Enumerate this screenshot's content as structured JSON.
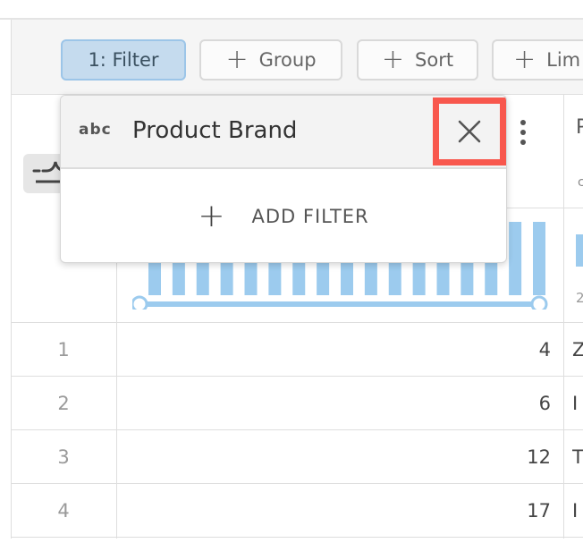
{
  "toolbar": {
    "buttons": [
      {
        "label": "1: Filter",
        "active": true
      },
      {
        "label": "Group",
        "icon": "plus-icon"
      },
      {
        "label": "Sort",
        "icon": "plus-icon"
      },
      {
        "label": "Lim",
        "icon": "plus-icon"
      }
    ]
  },
  "filter_popover": {
    "type_icon_label": "abc",
    "title": "Product Brand",
    "close_icon": "close-icon",
    "add_filter_label": "ADD FILTER",
    "highlight_color": "#f8574d"
  },
  "column": {
    "histogram_bar_color": "#9ccbee",
    "histogram_bars": 17
  },
  "rows": [
    {
      "num": "1",
      "value": "4",
      "next_col_partial": "Z"
    },
    {
      "num": "2",
      "value": "6",
      "next_col_partial": "I"
    },
    {
      "num": "3",
      "value": "12",
      "next_col_partial": "T"
    },
    {
      "num": "4",
      "value": "17",
      "next_col_partial": "I"
    }
  ],
  "next_column": {
    "header_partial": "P",
    "sub_partial": "c",
    "stat_partial": "2"
  }
}
